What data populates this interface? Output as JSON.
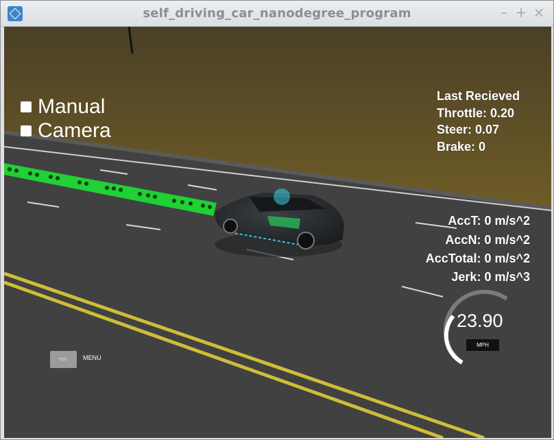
{
  "window": {
    "title": "self_driving_car_nanodegree_program",
    "controls": {
      "minimize": "–",
      "maximize": "+",
      "close": "×"
    }
  },
  "options": {
    "manual": "Manual",
    "camera": "Camera"
  },
  "telemetry": {
    "last_received": "Last Recieved",
    "throttle": "Throttle: 0.20",
    "steer": "Steer: 0.07",
    "brake": "Brake: 0",
    "acct": "AccT: 0 m/s^2",
    "accn": "AccN: 0 m/s^2",
    "acctotal": "AccTotal: 0 m/s^2",
    "jerk": "Jerk: 0 m/s^3"
  },
  "speedometer": {
    "value": "23.90",
    "unit": "MPH"
  },
  "menu": {
    "esc_label": "esc",
    "menu_label": "MENU"
  },
  "colors": {
    "path": "#1fd134",
    "lane_yellow": "#d5c63b",
    "road": "#3f3f3f",
    "terrain": "#5f5224"
  }
}
